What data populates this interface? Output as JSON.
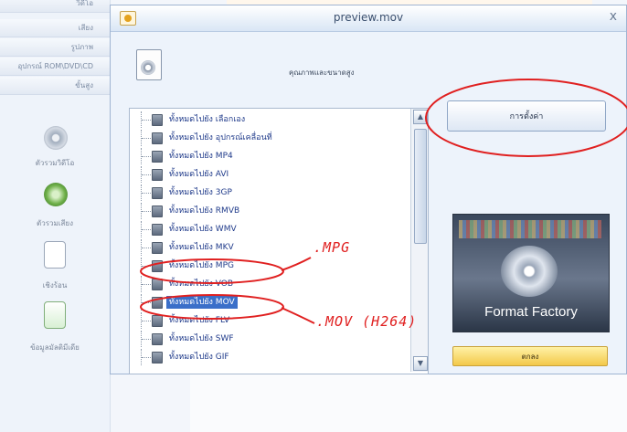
{
  "sidebar": {
    "tabs": [
      "วิดีโอ",
      "เสียง",
      "รูปภาพ",
      "อุปกรณ์ ROM\\DVD\\CD",
      "ขั้นสูง"
    ],
    "items": [
      {
        "label": "ตัวรวมวิดีโอ",
        "icon": "video-join-icon"
      },
      {
        "label": "ตัวรวมเสียง",
        "icon": "audio-join-icon"
      },
      {
        "label": "เชิงร้อน",
        "icon": "document-icon"
      },
      {
        "label": "ข้อมูลมัลติมีเดีย",
        "icon": "media-info-icon"
      }
    ]
  },
  "dialog": {
    "title": "preview.mov",
    "close": "x",
    "quality_label": "คุณภาพและขนาดสูง",
    "settings_button": "การตั้งค่า",
    "ok_button": "ตกลง",
    "logo_text": "Format Factory",
    "format_list": [
      {
        "label": "ทั้งหมดไปยัง เลือกเอง",
        "selected": false
      },
      {
        "label": "ทั้งหมดไปยัง อุปกรณ์เคลื่อนที่",
        "selected": false
      },
      {
        "label": "ทั้งหมดไปยัง MP4",
        "selected": false
      },
      {
        "label": "ทั้งหมดไปยัง AVI",
        "selected": false
      },
      {
        "label": "ทั้งหมดไปยัง 3GP",
        "selected": false
      },
      {
        "label": "ทั้งหมดไปยัง RMVB",
        "selected": false
      },
      {
        "label": "ทั้งหมดไปยัง WMV",
        "selected": false
      },
      {
        "label": "ทั้งหมดไปยัง MKV",
        "selected": false
      },
      {
        "label": "ทั้งหมดไปยัง MPG",
        "selected": false
      },
      {
        "label": "ทั้งหมดไปยัง VOB",
        "selected": false
      },
      {
        "label": "ทั้งหมดไปยัง MOV",
        "selected": true
      },
      {
        "label": "ทั้งหมดไปยัง FLV",
        "selected": false
      },
      {
        "label": "ทั้งหมดไปยัง SWF",
        "selected": false
      },
      {
        "label": "ทั้งหมดไปยัง GIF",
        "selected": false
      }
    ]
  },
  "annotations": {
    "mpg_note": ".MPG",
    "mov_note": ".MOV (H264)",
    "color": "#e02020"
  }
}
